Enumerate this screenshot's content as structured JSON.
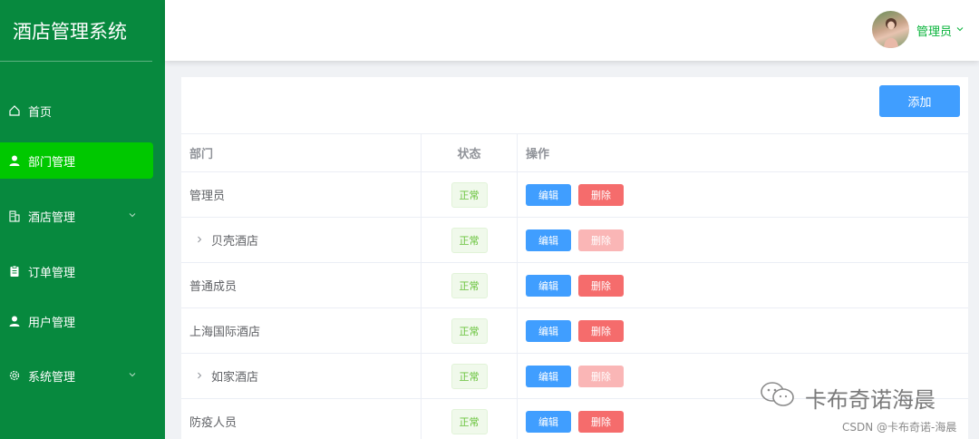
{
  "app": {
    "title": "酒店管理系统"
  },
  "sidebar": {
    "items": [
      {
        "label": "首页",
        "icon": "home-icon"
      },
      {
        "label": "部门管理",
        "icon": "user-icon",
        "active": true
      },
      {
        "label": "酒店管理",
        "icon": "building-icon",
        "has_children": true
      },
      {
        "label": "订单管理",
        "icon": "clipboard-icon"
      },
      {
        "label": "用户管理",
        "icon": "user-icon"
      },
      {
        "label": "系统管理",
        "icon": "gear-icon",
        "has_children": true
      }
    ]
  },
  "header": {
    "user_name": "管理员"
  },
  "toolbar": {
    "add_label": "添加"
  },
  "table": {
    "columns": [
      "部门",
      "状态",
      "操作"
    ],
    "rows": [
      {
        "name": "管理员",
        "status": "正常",
        "expandable": false,
        "delete_disabled": false
      },
      {
        "name": "贝壳酒店",
        "status": "正常",
        "expandable": true,
        "delete_disabled": true
      },
      {
        "name": "普通成员",
        "status": "正常",
        "expandable": false,
        "delete_disabled": false
      },
      {
        "name": "上海国际酒店",
        "status": "正常",
        "expandable": false,
        "delete_disabled": false
      },
      {
        "name": "如家酒店",
        "status": "正常",
        "expandable": true,
        "delete_disabled": true
      },
      {
        "name": "防疫人员",
        "status": "正常",
        "expandable": false,
        "delete_disabled": false
      }
    ],
    "edit_label": "编辑",
    "delete_label": "删除"
  },
  "watermark": {
    "text": "卡布奇诺海晨",
    "csdn": "CSDN @卡布奇诺-海晨"
  },
  "colors": {
    "sidebar": "#07893e",
    "active": "#00c800",
    "primary": "#409eff",
    "danger": "#f56c6c",
    "success": "#67c23a"
  }
}
